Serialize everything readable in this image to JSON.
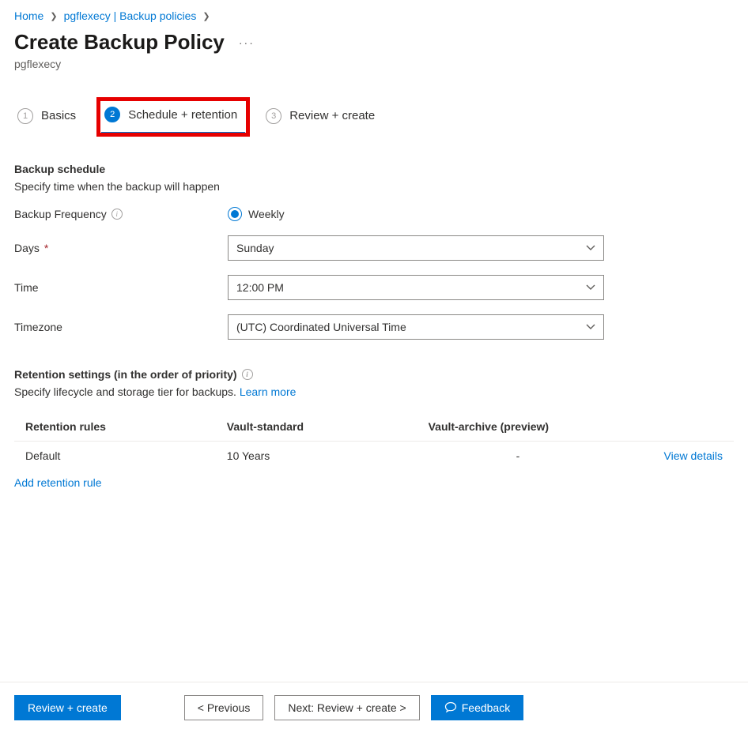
{
  "breadcrumb": {
    "home": "Home",
    "parent": "pgflexecy | Backup policies"
  },
  "header": {
    "title": "Create Backup Policy",
    "subtitle": "pgflexecy"
  },
  "steps": {
    "s1": {
      "num": "1",
      "label": "Basics"
    },
    "s2": {
      "num": "2",
      "label": "Schedule + retention"
    },
    "s3": {
      "num": "3",
      "label": "Review + create"
    }
  },
  "schedule": {
    "heading": "Backup schedule",
    "desc": "Specify time when the backup will happen",
    "freq_label": "Backup Frequency",
    "freq_value": "Weekly",
    "days_label": "Days",
    "days_value": "Sunday",
    "time_label": "Time",
    "time_value": "12:00 PM",
    "tz_label": "Timezone",
    "tz_value": "(UTC) Coordinated Universal Time"
  },
  "retention": {
    "heading": "Retention settings (in the order of priority)",
    "desc_prefix": "Specify lifecycle and storage tier for backups. ",
    "learn_more": "Learn more",
    "cols": {
      "rules": "Retention rules",
      "vault_std": "Vault-standard",
      "vault_arch": "Vault-archive (preview)"
    },
    "row": {
      "name": "Default",
      "vault_std": "10 Years",
      "vault_arch": "-",
      "view_details": "View details"
    },
    "add_rule": "Add retention rule"
  },
  "footer": {
    "review": "Review + create",
    "previous": "< Previous",
    "next": "Next: Review + create >",
    "feedback": "Feedback"
  }
}
